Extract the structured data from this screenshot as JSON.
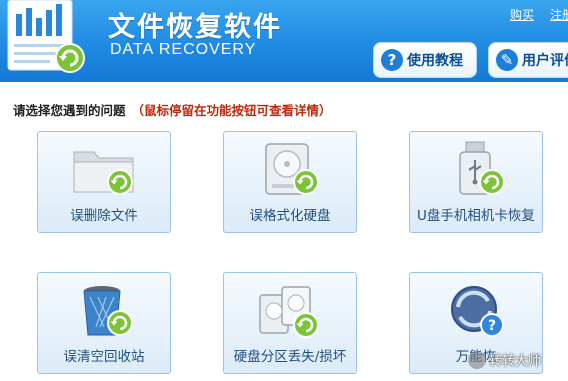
{
  "header": {
    "title_cn": "文件恢复软件",
    "title_en": "DATA RECOVERY",
    "links": {
      "buy": "购买",
      "register": "注册"
    },
    "buttons": {
      "tutorial": {
        "icon": "question-icon",
        "glyph": "?",
        "label": "使用教程"
      },
      "reviews": {
        "icon": "review-icon",
        "glyph": "✎",
        "label": "用户评价"
      }
    },
    "colors": {
      "header_blue": "#1f8be3",
      "button_text": "#0d4f94"
    }
  },
  "prompt": {
    "question": "请选择您遇到的问题",
    "hint": "（鼠标停留在功能按钮可查看详情）",
    "hint_color": "#c0290d"
  },
  "cards": [
    {
      "label": "误删除文件",
      "icon": "folder-recover-icon"
    },
    {
      "label": "误格式化硬盘",
      "icon": "hard-drive-recover-icon"
    },
    {
      "label": "U盘手机相机卡恢复",
      "icon": "usb-recover-icon"
    },
    {
      "label": "误清空回收站",
      "icon": "recycle-bin-recover-icon"
    },
    {
      "label": "硬盘分区丢失/损坏",
      "icon": "partition-recover-icon"
    },
    {
      "label": "万能恢",
      "icon": "universal-recover-icon"
    }
  ],
  "watermark": {
    "text": "转转大师"
  }
}
